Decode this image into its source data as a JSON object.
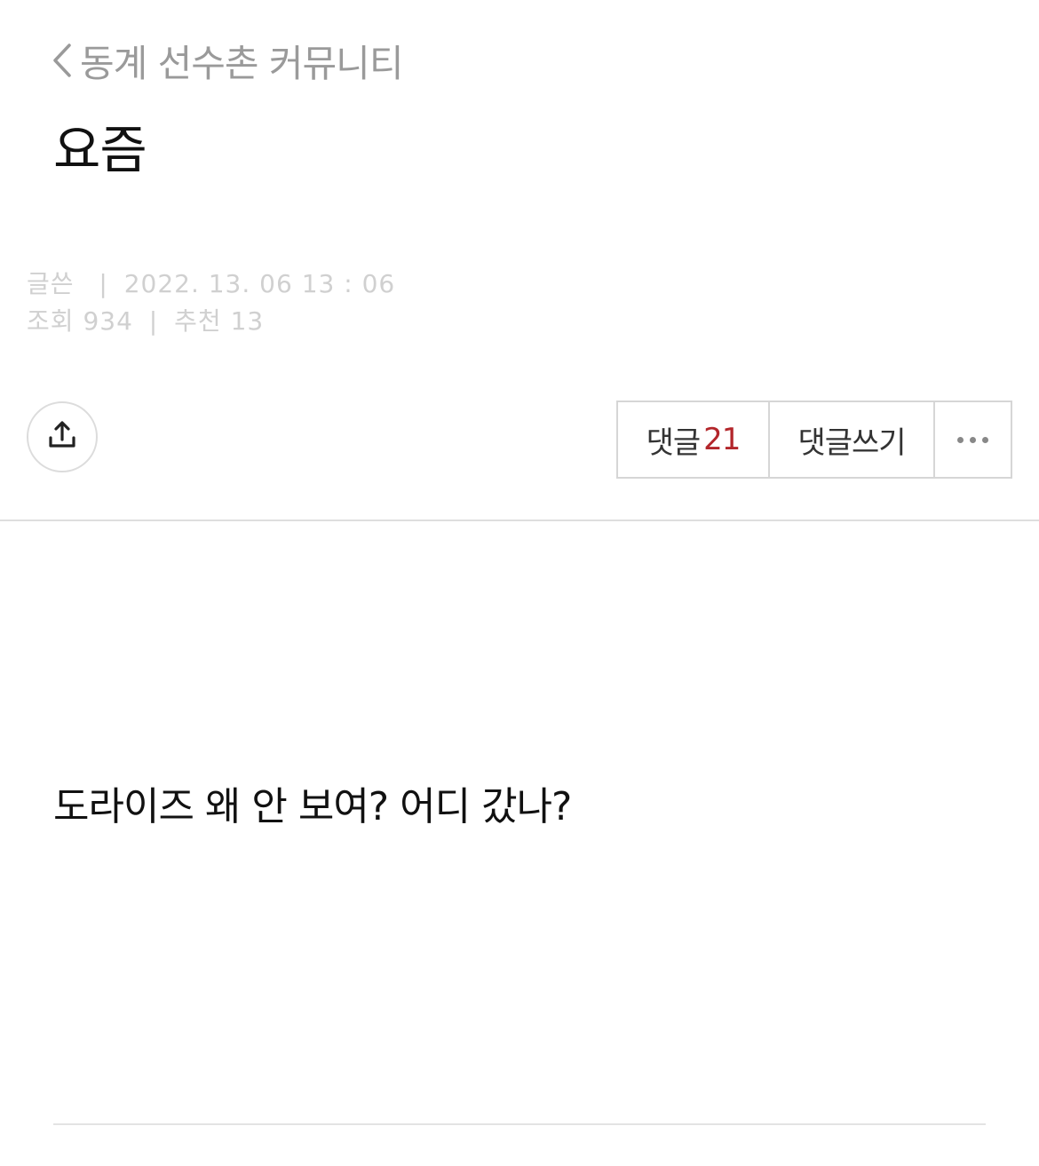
{
  "header": {
    "back_label": "동계 선수촌 커뮤니티"
  },
  "post": {
    "title": "요즘",
    "author_label": "글쓴",
    "date": "2022. 13. 06 13 : 06",
    "views_label": "조회",
    "views": "934",
    "recommend_label": "추천",
    "recommend": "13",
    "body": "도라이즈 왜 안 보여? 어디 갔나?"
  },
  "actions": {
    "comments_label": "댓글",
    "comments_count": "21",
    "write_comment_label": "댓글쓰기"
  },
  "colors": {
    "comment_count": "#b3262b",
    "meta_text": "#d0d0d0",
    "back_text": "#9a9a9a"
  },
  "icons": {
    "back": "chevron-left-icon",
    "share": "share-upload-icon",
    "more": "more-horizontal-icon"
  }
}
